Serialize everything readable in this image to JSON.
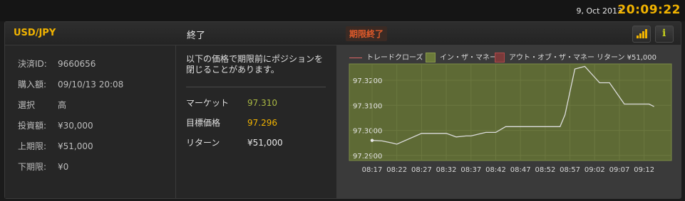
{
  "topbar": {
    "date": "9, Oct 2013",
    "clock": "20:09:22"
  },
  "header": {
    "pair": "USD/JPY",
    "status": "終了",
    "expired_badge": "期限終了",
    "chart_icon": "bar-chart-icon",
    "info_icon": "info-icon"
  },
  "details": [
    {
      "label": "決済ID:",
      "value": "9660656"
    },
    {
      "label": "購入額:",
      "value": "09/10/13 20:08"
    },
    {
      "label": "選択",
      "value": "高"
    },
    {
      "label": "投資額:",
      "value": "¥30,000"
    },
    {
      "label": "上期限:",
      "value": "¥51,000"
    },
    {
      "label": "下期限:",
      "value": "¥0"
    }
  ],
  "middle": {
    "note": "以下の価格で期限前にポジションを閉じることがあります。",
    "rows": [
      {
        "label": "マーケット",
        "value": "97.310"
      },
      {
        "label": "目標価格",
        "value": "97.296"
      },
      {
        "label": "リターン",
        "value": "¥51,000"
      }
    ]
  },
  "legend": {
    "trade_close": "トレードクローズ",
    "in_the_money": "イン・ザ・マネー",
    "out_of_money": "アウト・オブ・ザ・マネー",
    "return_label": "リターン ¥51,000",
    "colors": {
      "in_the_money": "#6b7a3a",
      "out_of_money": "#b24a4a",
      "trade_close": "#d66666"
    }
  },
  "chart_data": {
    "type": "line",
    "x": [
      "08:17",
      "08:22",
      "08:27",
      "08:32",
      "08:37",
      "08:42",
      "08:47",
      "08:52",
      "08:57",
      "09:02",
      "09:07",
      "09:12"
    ],
    "y_ticks": [
      "97.2900",
      "97.3000",
      "97.3100",
      "97.3200"
    ],
    "ylim": [
      97.288,
      97.3265
    ],
    "grid": true,
    "target_price": 97.296,
    "series": [
      {
        "points": [
          [
            "08:17",
            97.296
          ],
          [
            "08:19",
            97.2958
          ],
          [
            "08:21",
            97.295
          ],
          [
            "08:22",
            97.2945
          ],
          [
            "08:27",
            97.2988
          ],
          [
            "08:30",
            97.2988
          ],
          [
            "08:32",
            97.2988
          ],
          [
            "08:34",
            97.2974
          ],
          [
            "08:36",
            97.2978
          ],
          [
            "08:37",
            97.2978
          ],
          [
            "08:40",
            97.2992
          ],
          [
            "08:42",
            97.2992
          ],
          [
            "08:44",
            97.3015
          ],
          [
            "08:47",
            97.3015
          ],
          [
            "08:52",
            97.3015
          ],
          [
            "08:55",
            97.3015
          ],
          [
            "08:56",
            97.3063
          ],
          [
            "08:58",
            97.3245
          ],
          [
            "09:00",
            97.3255
          ],
          [
            "09:03",
            97.319
          ],
          [
            "09:05",
            97.319
          ],
          [
            "09:08",
            97.3105
          ],
          [
            "09:10",
            97.3105
          ],
          [
            "09:13",
            97.3105
          ],
          [
            "09:14",
            97.3095
          ]
        ]
      }
    ]
  }
}
